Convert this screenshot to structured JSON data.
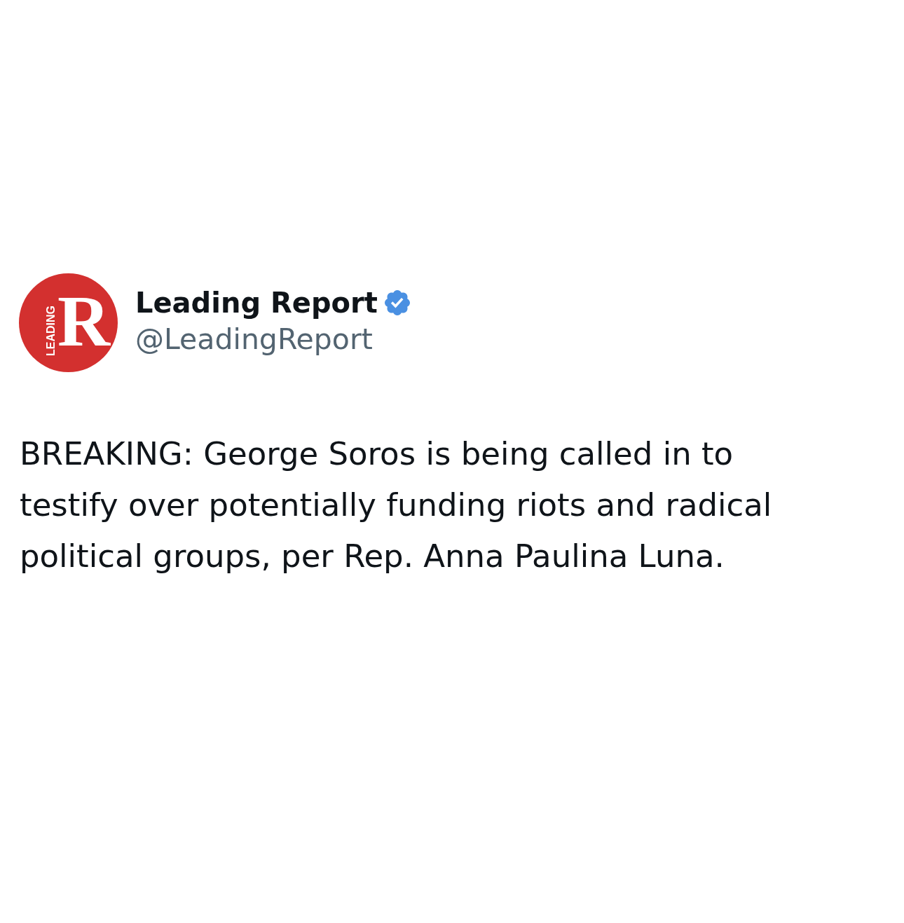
{
  "tweet": {
    "avatar": {
      "logo_text": "LEADING",
      "logo_letter": "R"
    },
    "author": {
      "name": "Leading Report",
      "verified": true,
      "handle": "@LeadingReport"
    },
    "text": "BREAKING: George Soros is being called in to testify over potentially funding riots and radical political groups, per Rep. Anna Paulina Luna."
  }
}
